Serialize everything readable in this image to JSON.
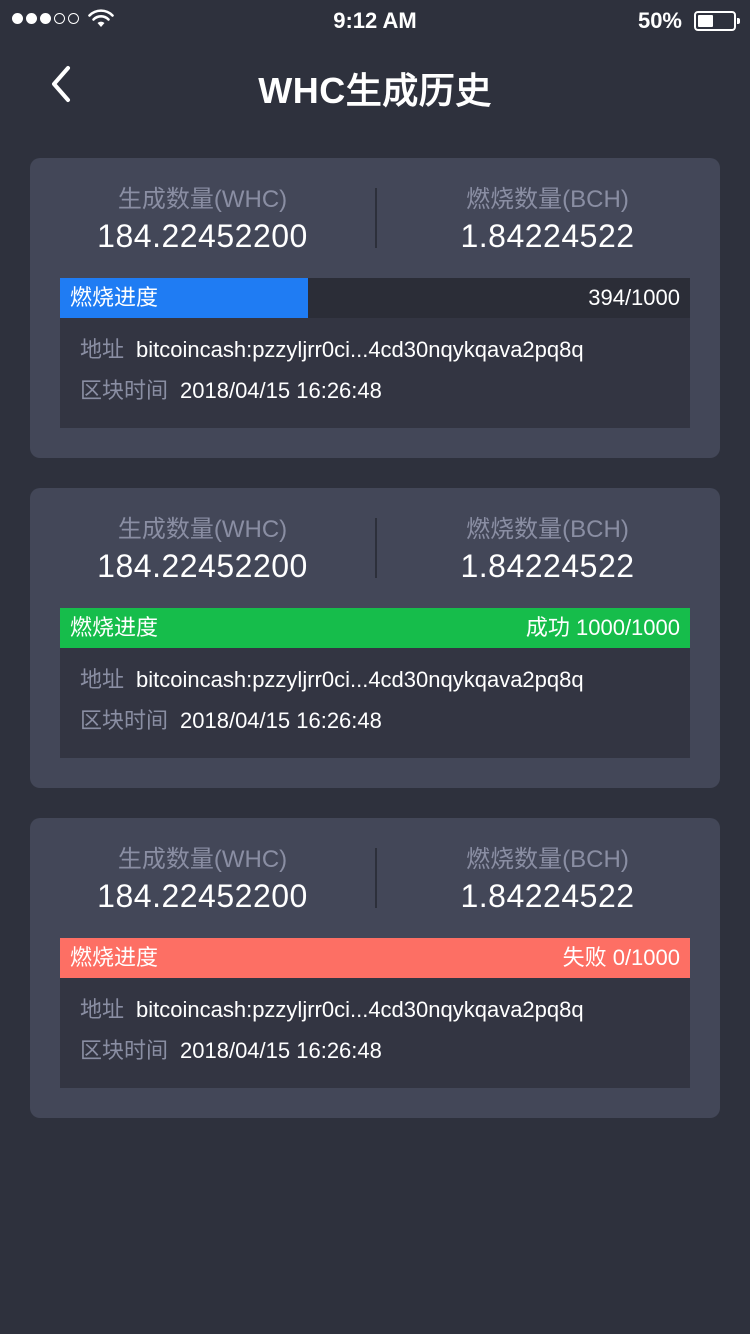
{
  "status_bar": {
    "time": "9:12 AM",
    "battery_percent": "50%",
    "battery_level": 0.5,
    "signal_bars_filled": 3,
    "signal_bars_total": 5
  },
  "nav": {
    "title": "WHC生成历史",
    "back_icon": "chevron-left-icon"
  },
  "records": [
    {
      "generated_label": "生成数量(WHC)",
      "generated_value": "184.22452200",
      "burned_label": "燃烧数量(BCH)",
      "burned_value": "1.84224522",
      "progress_label": "燃烧进度",
      "progress_text": "394/1000",
      "progress_fraction": 0.394,
      "progress_color": "#1f7cf3",
      "address_label": "地址",
      "address_value": "bitcoincash:pzzyljrr0ci...4cd30nqykqava2pq8q",
      "block_time_label": "区块时间",
      "block_time_value": "2018/04/15 16:26:48"
    },
    {
      "generated_label": "生成数量(WHC)",
      "generated_value": "184.22452200",
      "burned_label": "燃烧数量(BCH)",
      "burned_value": "1.84224522",
      "progress_label": "燃烧进度",
      "progress_text": "成功 1000/1000",
      "progress_fraction": 1.0,
      "progress_color": "#16bd4b",
      "address_label": "地址",
      "address_value": "bitcoincash:pzzyljrr0ci...4cd30nqykqava2pq8q",
      "block_time_label": "区块时间",
      "block_time_value": "2018/04/15 16:26:48"
    },
    {
      "generated_label": "生成数量(WHC)",
      "generated_value": "184.22452200",
      "burned_label": "燃烧数量(BCH)",
      "burned_value": "1.84224522",
      "progress_label": "燃烧进度",
      "progress_text": "失败 0/1000",
      "progress_fraction": 1.0,
      "progress_color": "#fd6f64",
      "address_label": "地址",
      "address_value": "bitcoincash:pzzyljrr0ci...4cd30nqykqava2pq8q",
      "block_time_label": "区块时间",
      "block_time_value": "2018/04/15 16:26:48"
    }
  ],
  "colors": {
    "background": "#2e313d",
    "card": "#434758",
    "muted_text": "#8a8ea3"
  }
}
